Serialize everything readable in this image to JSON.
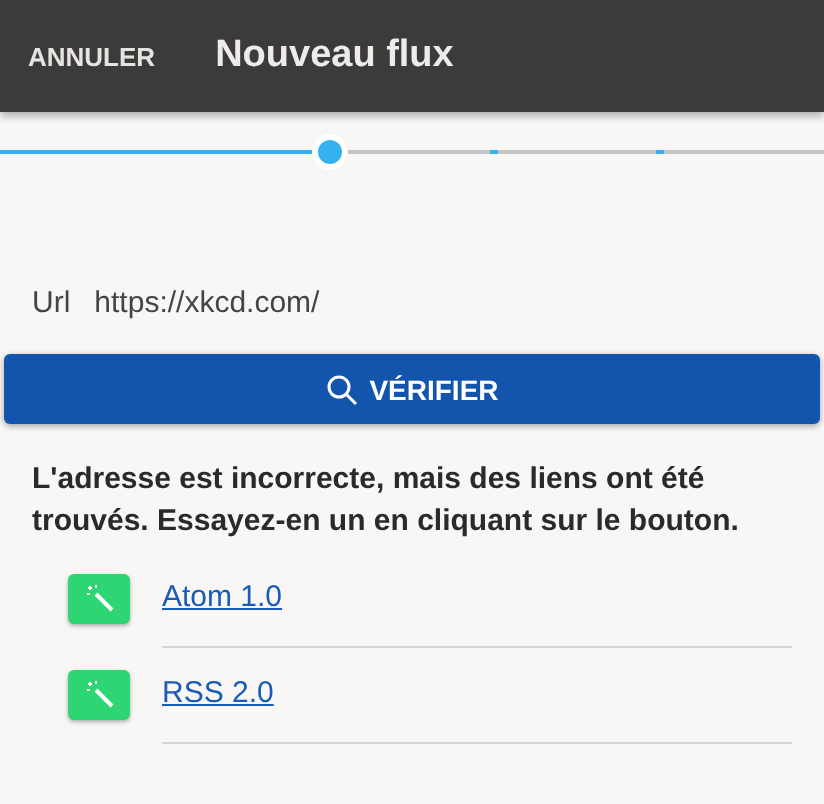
{
  "toolbar": {
    "cancel": "ANNULER",
    "title": "Nouveau flux"
  },
  "progress": {
    "level": 0.4
  },
  "url_field": {
    "label": "Url",
    "value": "https://xkcd.com/"
  },
  "verify_button": "VÉRIFIER",
  "message": "L'adresse est incorrecte, mais des liens ont été trouvés. Essayez-en un en cliquant sur le bouton.",
  "feeds": [
    {
      "label": "Atom 1.0"
    },
    {
      "label": "RSS 2.0"
    }
  ]
}
